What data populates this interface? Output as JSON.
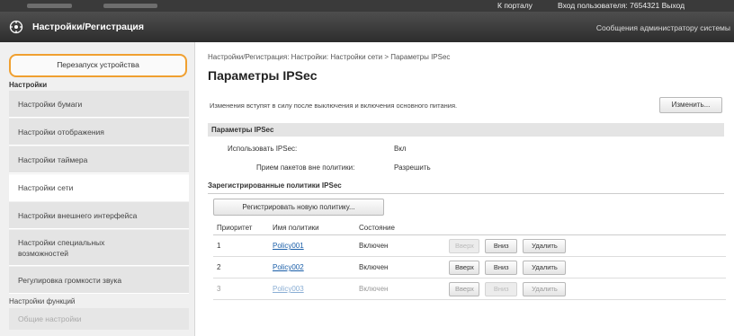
{
  "topbar": {
    "portal_link": "К порталу",
    "login_text": "Вход пользователя:  7654321  Выход"
  },
  "header": {
    "title": "Настройки/Регистрация",
    "admin_message": "Сообщения администратору системы"
  },
  "sidebar": {
    "restart_label": "Перезапуск устройства",
    "section_settings": "Настройки",
    "items": [
      {
        "label": "Настройки бумаги"
      },
      {
        "label": "Настройки отображения"
      },
      {
        "label": "Настройки таймера"
      },
      {
        "label": "Настройки сети"
      },
      {
        "label": "Настройки внешнего интерфейса"
      },
      {
        "label": "Настройки специальных возможностей"
      },
      {
        "label": "Регулировка громкости звука"
      }
    ],
    "section_functions": "Настройки функций",
    "section_functions_sub": "Общие настройки"
  },
  "main": {
    "breadcrumb": "Настройки/Регистрация: Настройки: Настройки сети > Параметры IPSec",
    "page_title": "Параметры IPSec",
    "notice": "Изменения вступят в силу после выключения и включения основного питания.",
    "edit_button": "Изменить...",
    "section_title": "Параметры IPSec",
    "use_ipsec_label": "Использовать IPSec:",
    "use_ipsec_value": "Вкл",
    "non_policy_label": "Прием пакетов вне политики:",
    "non_policy_value": "Разрешить",
    "registered_title": "Зарегистрированные политики IPSec",
    "register_button": "Регистрировать новую политику...",
    "columns": [
      "Приоритет",
      "Имя политики",
      "Состояние"
    ],
    "policies": [
      {
        "priority": "1",
        "name": "Policy001",
        "state": "Включен",
        "up": "Вверх",
        "down": "Вниз",
        "delete": "Удалить"
      },
      {
        "priority": "2",
        "name": "Policy002",
        "state": "Включен",
        "up": "Вверх",
        "down": "Вниз",
        "delete": "Удалить"
      },
      {
        "priority": "3",
        "name": "Policy003",
        "state": "Включен",
        "up": "Вверх",
        "down": "Вниз",
        "delete": "Удалить"
      }
    ]
  }
}
